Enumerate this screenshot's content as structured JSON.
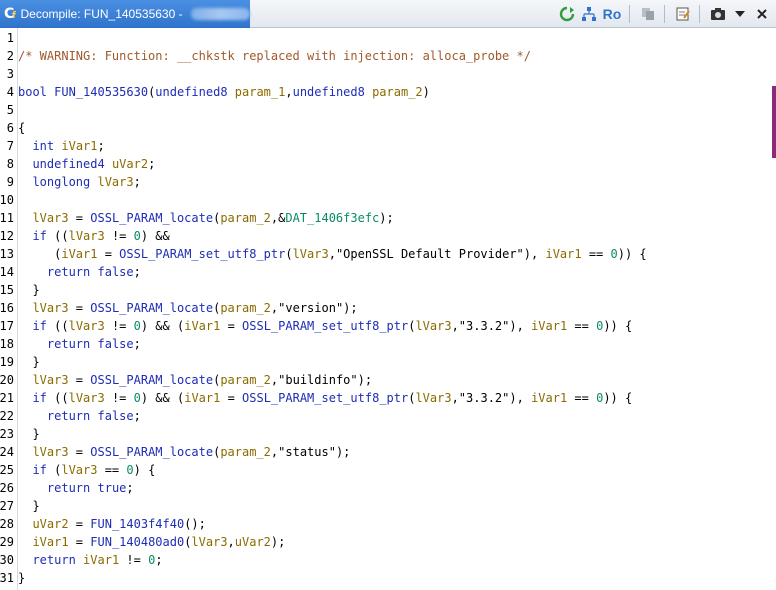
{
  "window": {
    "title": "Decompile: FUN_140535630 -"
  },
  "toolbar": {
    "ro_label": "Ro"
  },
  "code": {
    "lines": [
      {
        "n": "1",
        "tokens": []
      },
      {
        "n": "2",
        "tokens": [
          {
            "t": "/* WARNING: Function: __chkstk replaced with injection: alloca_probe */",
            "c": "comment"
          }
        ]
      },
      {
        "n": "3",
        "tokens": []
      },
      {
        "n": "4",
        "tokens": [
          {
            "t": "bool",
            "c": "type"
          },
          {
            "t": " ",
            "c": ""
          },
          {
            "t": "FUN_140535630",
            "c": "func"
          },
          {
            "t": "(",
            "c": ""
          },
          {
            "t": "undefined8",
            "c": "type"
          },
          {
            "t": " ",
            "c": ""
          },
          {
            "t": "param_1",
            "c": "param"
          },
          {
            "t": ",",
            "c": ""
          },
          {
            "t": "undefined8",
            "c": "type"
          },
          {
            "t": " ",
            "c": ""
          },
          {
            "t": "param_2",
            "c": "param"
          },
          {
            "t": ")",
            "c": ""
          }
        ]
      },
      {
        "n": "5",
        "tokens": []
      },
      {
        "n": "6",
        "tokens": [
          {
            "t": "{",
            "c": ""
          }
        ]
      },
      {
        "n": "7",
        "tokens": [
          {
            "t": "  ",
            "c": ""
          },
          {
            "t": "int",
            "c": "type"
          },
          {
            "t": " ",
            "c": ""
          },
          {
            "t": "iVar1",
            "c": "var"
          },
          {
            "t": ";",
            "c": ""
          }
        ]
      },
      {
        "n": "8",
        "tokens": [
          {
            "t": "  ",
            "c": ""
          },
          {
            "t": "undefined4",
            "c": "type"
          },
          {
            "t": " ",
            "c": ""
          },
          {
            "t": "uVar2",
            "c": "var"
          },
          {
            "t": ";",
            "c": ""
          }
        ]
      },
      {
        "n": "9",
        "tokens": [
          {
            "t": "  ",
            "c": ""
          },
          {
            "t": "longlong",
            "c": "type"
          },
          {
            "t": " ",
            "c": ""
          },
          {
            "t": "lVar3",
            "c": "var"
          },
          {
            "t": ";",
            "c": ""
          }
        ]
      },
      {
        "n": "10",
        "tokens": []
      },
      {
        "n": "11",
        "tokens": [
          {
            "t": "  ",
            "c": ""
          },
          {
            "t": "lVar3",
            "c": "var"
          },
          {
            "t": " = ",
            "c": ""
          },
          {
            "t": "OSSL_PARAM_locate",
            "c": "func"
          },
          {
            "t": "(",
            "c": ""
          },
          {
            "t": "param_2",
            "c": "param"
          },
          {
            "t": ",&",
            "c": ""
          },
          {
            "t": "DAT_1406f3efc",
            "c": "data"
          },
          {
            "t": ");",
            "c": ""
          }
        ]
      },
      {
        "n": "12",
        "tokens": [
          {
            "t": "  ",
            "c": ""
          },
          {
            "t": "if",
            "c": "kw"
          },
          {
            "t": " ((",
            "c": ""
          },
          {
            "t": "lVar3",
            "c": "var"
          },
          {
            "t": " != ",
            "c": ""
          },
          {
            "t": "0",
            "c": "num"
          },
          {
            "t": ") &&",
            "c": ""
          }
        ]
      },
      {
        "n": "13",
        "tokens": [
          {
            "t": "     (",
            "c": ""
          },
          {
            "t": "iVar1",
            "c": "var"
          },
          {
            "t": " = ",
            "c": ""
          },
          {
            "t": "OSSL_PARAM_set_utf8_ptr",
            "c": "func"
          },
          {
            "t": "(",
            "c": ""
          },
          {
            "t": "lVar3",
            "c": "var"
          },
          {
            "t": ",",
            "c": ""
          },
          {
            "t": "\"OpenSSL Default Provider\"",
            "c": "str"
          },
          {
            "t": "), ",
            "c": ""
          },
          {
            "t": "iVar1",
            "c": "var"
          },
          {
            "t": " == ",
            "c": ""
          },
          {
            "t": "0",
            "c": "num"
          },
          {
            "t": ")) {",
            "c": ""
          }
        ]
      },
      {
        "n": "14",
        "tokens": [
          {
            "t": "    ",
            "c": ""
          },
          {
            "t": "return",
            "c": "kw"
          },
          {
            "t": " ",
            "c": ""
          },
          {
            "t": "false",
            "c": "kw"
          },
          {
            "t": ";",
            "c": ""
          }
        ]
      },
      {
        "n": "15",
        "tokens": [
          {
            "t": "  }",
            "c": ""
          }
        ]
      },
      {
        "n": "16",
        "tokens": [
          {
            "t": "  ",
            "c": ""
          },
          {
            "t": "lVar3",
            "c": "var"
          },
          {
            "t": " = ",
            "c": ""
          },
          {
            "t": "OSSL_PARAM_locate",
            "c": "func"
          },
          {
            "t": "(",
            "c": ""
          },
          {
            "t": "param_2",
            "c": "param"
          },
          {
            "t": ",",
            "c": ""
          },
          {
            "t": "\"version\"",
            "c": "str"
          },
          {
            "t": ");",
            "c": ""
          }
        ]
      },
      {
        "n": "17",
        "tokens": [
          {
            "t": "  ",
            "c": ""
          },
          {
            "t": "if",
            "c": "kw"
          },
          {
            "t": " ((",
            "c": ""
          },
          {
            "t": "lVar3",
            "c": "var"
          },
          {
            "t": " != ",
            "c": ""
          },
          {
            "t": "0",
            "c": "num"
          },
          {
            "t": ") && (",
            "c": ""
          },
          {
            "t": "iVar1",
            "c": "var"
          },
          {
            "t": " = ",
            "c": ""
          },
          {
            "t": "OSSL_PARAM_set_utf8_ptr",
            "c": "func"
          },
          {
            "t": "(",
            "c": ""
          },
          {
            "t": "lVar3",
            "c": "var"
          },
          {
            "t": ",",
            "c": ""
          },
          {
            "t": "\"3.3.2\"",
            "c": "str"
          },
          {
            "t": "), ",
            "c": ""
          },
          {
            "t": "iVar1",
            "c": "var"
          },
          {
            "t": " == ",
            "c": ""
          },
          {
            "t": "0",
            "c": "num"
          },
          {
            "t": ")) {",
            "c": ""
          }
        ]
      },
      {
        "n": "18",
        "tokens": [
          {
            "t": "    ",
            "c": ""
          },
          {
            "t": "return",
            "c": "kw"
          },
          {
            "t": " ",
            "c": ""
          },
          {
            "t": "false",
            "c": "kw"
          },
          {
            "t": ";",
            "c": ""
          }
        ]
      },
      {
        "n": "19",
        "tokens": [
          {
            "t": "  }",
            "c": ""
          }
        ]
      },
      {
        "n": "20",
        "tokens": [
          {
            "t": "  ",
            "c": ""
          },
          {
            "t": "lVar3",
            "c": "var"
          },
          {
            "t": " = ",
            "c": ""
          },
          {
            "t": "OSSL_PARAM_locate",
            "c": "func"
          },
          {
            "t": "(",
            "c": ""
          },
          {
            "t": "param_2",
            "c": "param"
          },
          {
            "t": ",",
            "c": ""
          },
          {
            "t": "\"buildinfo\"",
            "c": "str"
          },
          {
            "t": ");",
            "c": ""
          }
        ]
      },
      {
        "n": "21",
        "tokens": [
          {
            "t": "  ",
            "c": ""
          },
          {
            "t": "if",
            "c": "kw"
          },
          {
            "t": " ((",
            "c": ""
          },
          {
            "t": "lVar3",
            "c": "var"
          },
          {
            "t": " != ",
            "c": ""
          },
          {
            "t": "0",
            "c": "num"
          },
          {
            "t": ") && (",
            "c": ""
          },
          {
            "t": "iVar1",
            "c": "var"
          },
          {
            "t": " = ",
            "c": ""
          },
          {
            "t": "OSSL_PARAM_set_utf8_ptr",
            "c": "func"
          },
          {
            "t": "(",
            "c": ""
          },
          {
            "t": "lVar3",
            "c": "var"
          },
          {
            "t": ",",
            "c": ""
          },
          {
            "t": "\"3.3.2\"",
            "c": "str"
          },
          {
            "t": "), ",
            "c": ""
          },
          {
            "t": "iVar1",
            "c": "var"
          },
          {
            "t": " == ",
            "c": ""
          },
          {
            "t": "0",
            "c": "num"
          },
          {
            "t": ")) {",
            "c": ""
          }
        ]
      },
      {
        "n": "22",
        "tokens": [
          {
            "t": "    ",
            "c": ""
          },
          {
            "t": "return",
            "c": "kw"
          },
          {
            "t": " ",
            "c": ""
          },
          {
            "t": "false",
            "c": "kw"
          },
          {
            "t": ";",
            "c": ""
          }
        ]
      },
      {
        "n": "23",
        "tokens": [
          {
            "t": "  }",
            "c": ""
          }
        ]
      },
      {
        "n": "24",
        "tokens": [
          {
            "t": "  ",
            "c": ""
          },
          {
            "t": "lVar3",
            "c": "var"
          },
          {
            "t": " = ",
            "c": ""
          },
          {
            "t": "OSSL_PARAM_locate",
            "c": "func"
          },
          {
            "t": "(",
            "c": ""
          },
          {
            "t": "param_2",
            "c": "param"
          },
          {
            "t": ",",
            "c": ""
          },
          {
            "t": "\"status\"",
            "c": "str"
          },
          {
            "t": ");",
            "c": ""
          }
        ]
      },
      {
        "n": "25",
        "tokens": [
          {
            "t": "  ",
            "c": ""
          },
          {
            "t": "if",
            "c": "kw"
          },
          {
            "t": " (",
            "c": ""
          },
          {
            "t": "lVar3",
            "c": "var"
          },
          {
            "t": " == ",
            "c": ""
          },
          {
            "t": "0",
            "c": "num"
          },
          {
            "t": ") {",
            "c": ""
          }
        ]
      },
      {
        "n": "26",
        "tokens": [
          {
            "t": "    ",
            "c": ""
          },
          {
            "t": "return",
            "c": "kw"
          },
          {
            "t": " ",
            "c": ""
          },
          {
            "t": "true",
            "c": "kw"
          },
          {
            "t": ";",
            "c": ""
          }
        ]
      },
      {
        "n": "27",
        "tokens": [
          {
            "t": "  }",
            "c": ""
          }
        ]
      },
      {
        "n": "28",
        "tokens": [
          {
            "t": "  ",
            "c": ""
          },
          {
            "t": "uVar2",
            "c": "var"
          },
          {
            "t": " = ",
            "c": ""
          },
          {
            "t": "FUN_1403f4f40",
            "c": "func"
          },
          {
            "t": "();",
            "c": ""
          }
        ]
      },
      {
        "n": "29",
        "tokens": [
          {
            "t": "  ",
            "c": ""
          },
          {
            "t": "iVar1",
            "c": "var"
          },
          {
            "t": " = ",
            "c": ""
          },
          {
            "t": "FUN_140480ad0",
            "c": "func"
          },
          {
            "t": "(",
            "c": ""
          },
          {
            "t": "lVar3",
            "c": "var"
          },
          {
            "t": ",",
            "c": ""
          },
          {
            "t": "uVar2",
            "c": "var"
          },
          {
            "t": ");",
            "c": ""
          }
        ]
      },
      {
        "n": "30",
        "tokens": [
          {
            "t": "  ",
            "c": ""
          },
          {
            "t": "return",
            "c": "kw"
          },
          {
            "t": " ",
            "c": ""
          },
          {
            "t": "iVar1",
            "c": "var"
          },
          {
            "t": " != ",
            "c": ""
          },
          {
            "t": "0",
            "c": "num"
          },
          {
            "t": ";",
            "c": ""
          }
        ]
      },
      {
        "n": "31",
        "tokens": [
          {
            "t": "}",
            "c": ""
          }
        ]
      }
    ]
  },
  "colors": {
    "tab_bg": "#2f74cc",
    "keyword": "#1e2db5",
    "variable": "#8a6b00",
    "number": "#0a8a6a",
    "comment": "#a05a2c"
  }
}
